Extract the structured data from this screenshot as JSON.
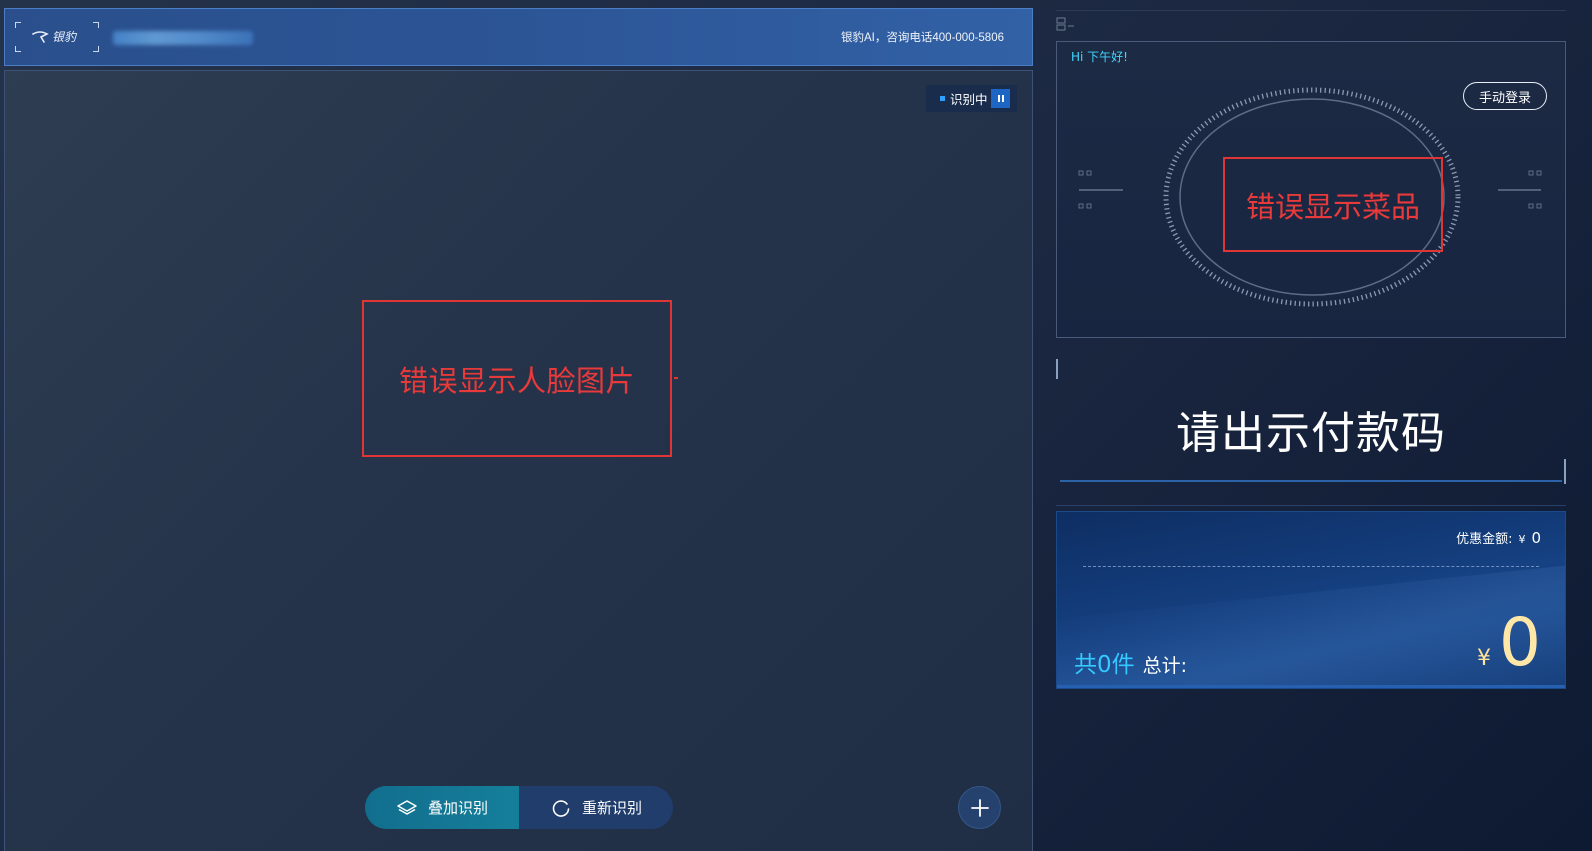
{
  "header": {
    "logo_text": "银豹",
    "info": "银豹AI，咨询电话400-000-5806"
  },
  "camera": {
    "status_text": "识别中",
    "annotation_face": "错误显示人脸图片",
    "buttons": {
      "add_recognition": "叠加识别",
      "re_recognition": "重新识别"
    }
  },
  "right": {
    "greeting": "Hi 下午好!",
    "login_button": "手动登录",
    "annotation_dish": "错误显示菜品",
    "pay_prompt": "请出示付款码",
    "summary": {
      "discount_label": "优惠金额:",
      "discount_currency": "¥",
      "discount_value": "0",
      "count_text": "共0件",
      "total_label": "总计:",
      "total_currency": "¥",
      "total_value": "0"
    }
  },
  "colors": {
    "accent_cyan": "#34c9ff",
    "annotation_red": "#e03535",
    "amount_yellow": "#ffe7a8"
  },
  "icons": [
    "layers-icon",
    "refresh-icon",
    "plus-icon",
    "pause-icon",
    "logo-icon"
  ]
}
